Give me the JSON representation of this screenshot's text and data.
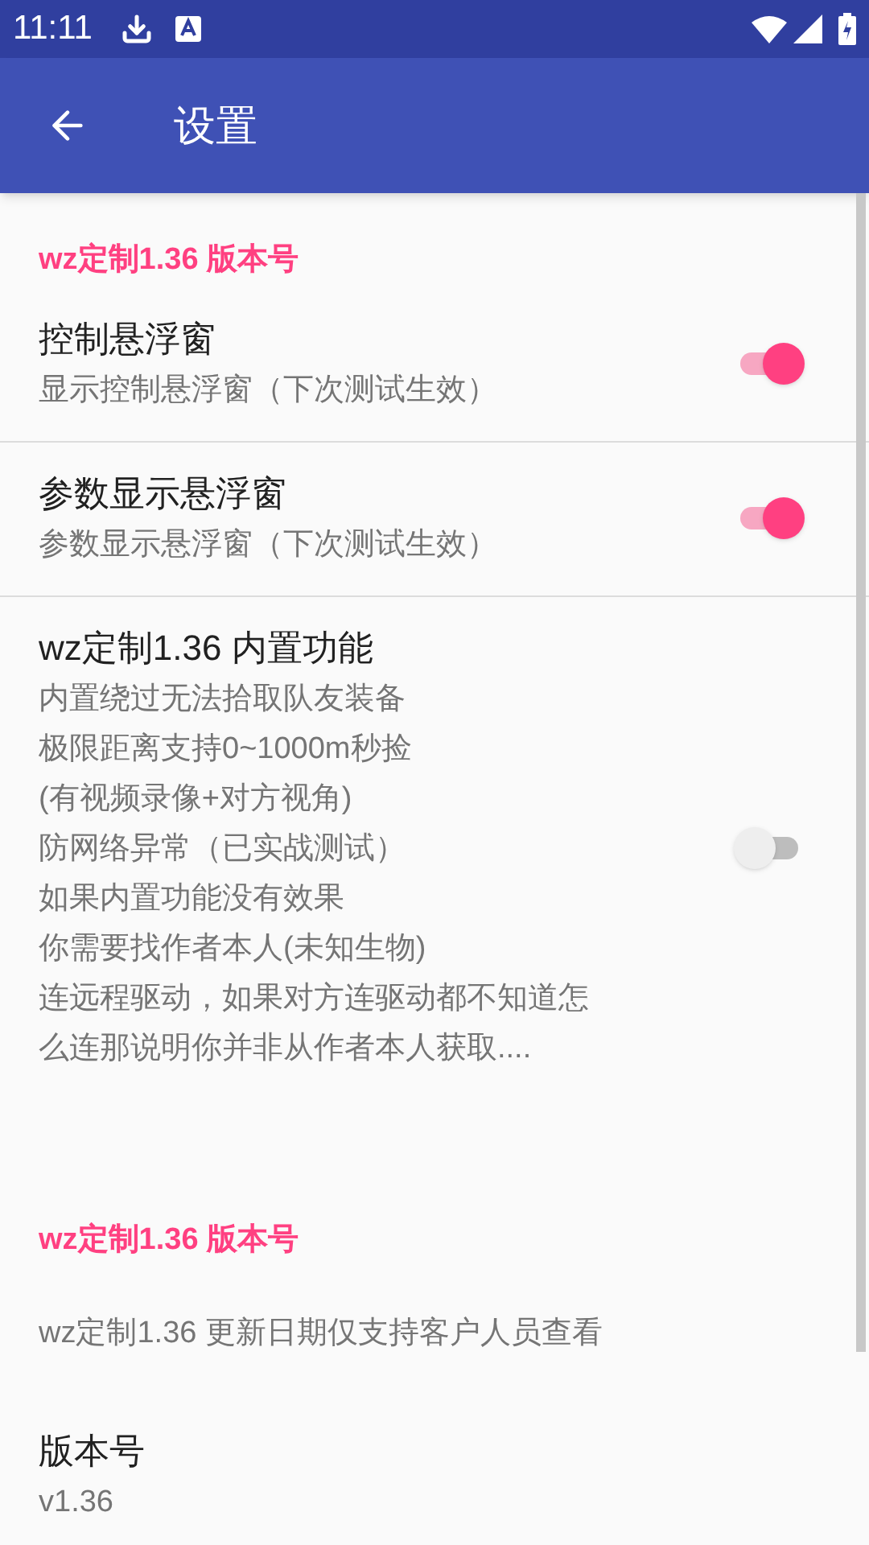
{
  "status_bar": {
    "time": "11:11"
  },
  "toolbar": {
    "title": "设置"
  },
  "sections": [
    {
      "header": "wz定制1.36 版本号",
      "items": [
        {
          "kind": "switch",
          "title": "控制悬浮窗",
          "summary": [
            "显示控制悬浮窗（下次测试生效）"
          ],
          "on": true
        },
        {
          "kind": "switch",
          "title": "参数显示悬浮窗",
          "summary": [
            "参数显示悬浮窗（下次测试生效）"
          ],
          "on": true
        },
        {
          "kind": "switch",
          "title": "wz定制1.36 内置功能",
          "summary": [
            "内置绕过无法拾取队友装备",
            "极限距离支持0~1000m秒捡",
            "(有视频录像+对方视角)",
            "防网络异常（已实战测试）",
            "如果内置功能没有效果",
            "你需要找作者本人(未知生物)",
            "连远程驱动，如果对方连驱动都不知道怎",
            "么连那说明你并非从作者本人获取...."
          ],
          "on": false
        }
      ]
    },
    {
      "header": "wz定制1.36 版本号",
      "items": [
        {
          "kind": "text",
          "summary": [
            "wz定制1.36 更新日期仅支持客户人员查看"
          ]
        },
        {
          "kind": "info",
          "title": "版本号",
          "summary": [
            "v1.36"
          ]
        }
      ]
    }
  ]
}
